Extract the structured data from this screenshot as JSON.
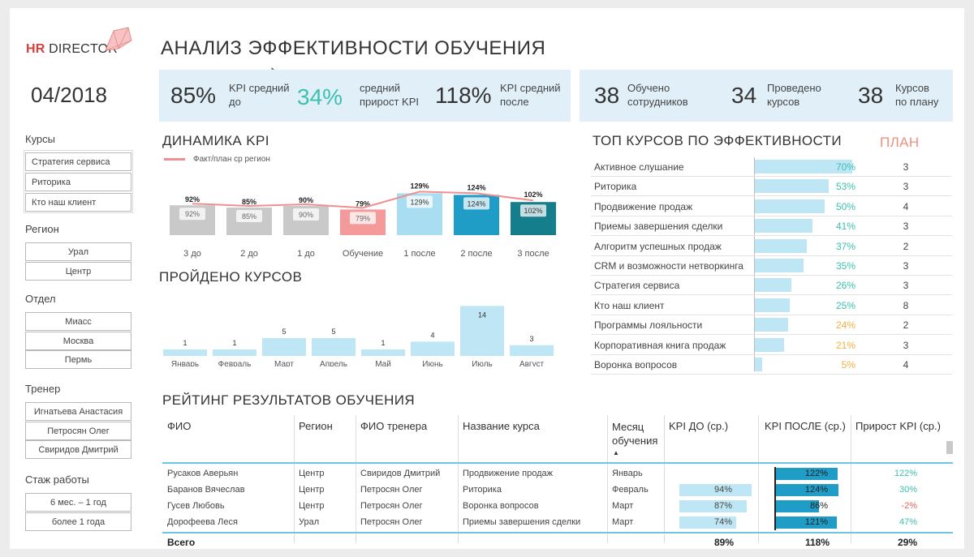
{
  "logo": {
    "hr": "HR",
    "rest": " DIRECTOR"
  },
  "period": "04/2018",
  "title": "АНАЛИЗ ЭФФЕКТИВНОСТИ ОБУЧЕНИЯ",
  "filters": {
    "courses": {
      "label": "Курсы",
      "items": [
        "Стратегия сервиса",
        "Риторика",
        "Кто наш клиент"
      ]
    },
    "region": {
      "label": "Регион",
      "items": [
        "Урал",
        "Центр"
      ]
    },
    "department": {
      "label": "Отдел",
      "items": [
        "Миасс",
        "Москва",
        "Пермь"
      ]
    },
    "trainer": {
      "label": "Тренер",
      "items": [
        "Игнатьева Анастасия",
        "Петросян Олег",
        "Свиридов Дмитрий"
      ]
    },
    "experience": {
      "label": "Стаж работы",
      "items": [
        "6 мес. – 1 год",
        "более 1 года"
      ]
    }
  },
  "kpi": {
    "before_value": "85%",
    "before_label_1": "KPI средний",
    "before_label_2": "до",
    "growth_value": "34%",
    "growth_label_1": "средний",
    "growth_label_2": "прирост KPI",
    "after_value": "118%",
    "after_label_1": "KPI средний",
    "after_label_2": "после",
    "trained_value": "38",
    "trained_label_1": "Обучено",
    "trained_label_2": "сотрудников",
    "held_value": "34",
    "held_label_1": "Проведено",
    "held_label_2": "курсов",
    "planned_value": "38",
    "planned_label_1": "Курсов",
    "planned_label_2": "по плану",
    "growth_color": "#3cc0b0"
  },
  "sections": {
    "dynamics": "ДИНАМИКА KPI",
    "courses_passed": "ПРОЙДЕНО КУРСОВ",
    "top_courses": "ТОП КУРСОВ ПО ЭФФЕКТИВНОСТИ",
    "plan": "ПЛАН",
    "rating": "РЕЙТИНГ РЕЗУЛЬТАТОВ ОБУЧЕНИЯ"
  },
  "chart_data": [
    {
      "type": "bar",
      "title": "ДИНАМИКА KPI",
      "legend": "Факт/план ср регион",
      "categories": [
        "3 до",
        "2 до",
        "1 до",
        "Обучение",
        "1 после",
        "2 после",
        "3 после"
      ],
      "values": [
        92,
        85,
        90,
        79,
        129,
        124,
        102
      ],
      "labels": [
        "92%",
        "85%",
        "90%",
        "79%",
        "129%",
        "124%",
        "102%"
      ],
      "line_values": [
        92,
        85,
        90,
        79,
        129,
        124,
        102
      ],
      "colors": [
        "#c9c9c9",
        "#c9c9c9",
        "#c9c9c9",
        "#f49a9a",
        "#a9ddf2",
        "#1f9dc7",
        "#147e8c"
      ],
      "line_color": "#f08f8f"
    },
    {
      "type": "bar",
      "title": "ПРОЙДЕНО КУРСОВ",
      "categories": [
        "Январь",
        "Февраль",
        "Март",
        "Апрель",
        "Май",
        "Июнь",
        "Июль",
        "Август"
      ],
      "values": [
        1,
        1,
        5,
        5,
        1,
        4,
        14,
        3
      ],
      "color": "#bfe6f4"
    }
  ],
  "top_courses": [
    {
      "name": "Активное слушание",
      "value": 70,
      "label": "70%",
      "plan": "3",
      "color": "#3cc0b0"
    },
    {
      "name": "Риторика",
      "value": 53,
      "label": "53%",
      "plan": "3",
      "color": "#3cc0b0"
    },
    {
      "name": "Продвижение продаж",
      "value": 50,
      "label": "50%",
      "plan": "4",
      "color": "#3cc0b0"
    },
    {
      "name": "Приемы завершения сделки",
      "value": 41,
      "label": "41%",
      "plan": "3",
      "color": "#3cc0b0"
    },
    {
      "name": "Алгоритм успешных продаж",
      "value": 37,
      "label": "37%",
      "plan": "2",
      "color": "#3cc0b0"
    },
    {
      "name": "CRM и возможности нетворкинга",
      "value": 35,
      "label": "35%",
      "plan": "3",
      "color": "#3cc0b0"
    },
    {
      "name": "Стратегия сервиса",
      "value": 26,
      "label": "26%",
      "plan": "3",
      "color": "#3cc0b0"
    },
    {
      "name": "Кто наш клиент",
      "value": 25,
      "label": "25%",
      "plan": "8",
      "color": "#3cc0b0"
    },
    {
      "name": "Программы лояльности",
      "value": 24,
      "label": "24%",
      "plan": "2",
      "color": "#f0b13c"
    },
    {
      "name": "Корпоративная книга продаж",
      "value": 21,
      "label": "21%",
      "plan": "3",
      "color": "#f0b13c"
    },
    {
      "name": "Воронка вопросов",
      "value": 5,
      "label": "5%",
      "plan": "4",
      "color": "#f0b13c"
    }
  ],
  "rating": {
    "headers": {
      "fio": "ФИО",
      "region": "Регион",
      "trainer": "ФИО тренера",
      "course": "Название курса",
      "month_1": "Месяц",
      "month_2": "обучения",
      "kpi_before": "KPI ДО (ср.)",
      "kpi_after": "KPI ПОСЛЕ (ср.)",
      "growth": "Прирост KPI (ср.)"
    },
    "rows": [
      {
        "fio": "Русаков Аверьян",
        "region": "Центр",
        "trainer": "Свиридов Дмитрий",
        "course": "Продвижение продаж",
        "month": "Январь",
        "kpi_before": "",
        "kpi_before_val": 0,
        "kpi_after": "122%",
        "kpi_after_val": 122,
        "growth": "122%",
        "growth_color": "#3cc0b0"
      },
      {
        "fio": "Баранов Вячеслав",
        "region": "Центр",
        "trainer": "Петросян Олег",
        "course": "Риторика",
        "month": "Февраль",
        "kpi_before": "94%",
        "kpi_before_val": 94,
        "kpi_after": "124%",
        "kpi_after_val": 124,
        "growth": "30%",
        "growth_color": "#3cc0b0"
      },
      {
        "fio": "Гусев Любовь",
        "region": "Центр",
        "trainer": "Петросян Олег",
        "course": "Воронка вопросов",
        "month": "Март",
        "kpi_before": "87%",
        "kpi_before_val": 87,
        "kpi_after": "86%",
        "kpi_after_val": 86,
        "growth": "-2%",
        "growth_color": "#e0645f"
      },
      {
        "fio": "Дорофеева Леся",
        "region": "Урал",
        "trainer": "Петросян Олег",
        "course": "Приемы завершения сделки",
        "month": "Март",
        "kpi_before": "74%",
        "kpi_before_val": 74,
        "kpi_after": "121%",
        "kpi_after_val": 121,
        "growth": "47%",
        "growth_color": "#3cc0b0"
      }
    ],
    "total": {
      "label": "Всего",
      "kpi_before": "89%",
      "kpi_after": "118%",
      "growth": "29%"
    }
  }
}
